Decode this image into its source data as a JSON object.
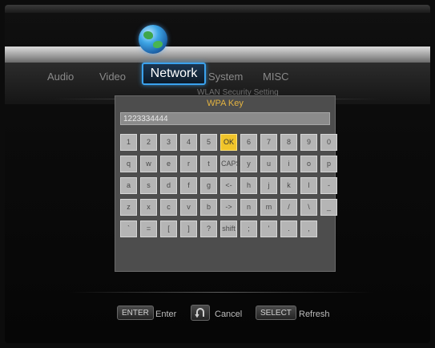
{
  "tabs": [
    {
      "label": "Audio"
    },
    {
      "label": "Video"
    },
    {
      "label": "Network"
    },
    {
      "label": "System"
    },
    {
      "label": "MISC"
    }
  ],
  "active_tab": "Network",
  "subtitle": "WLAN Security Setting",
  "dialog": {
    "title": "WPA Key",
    "value": "1223334444"
  },
  "keyboard": {
    "rows": [
      [
        "1",
        "2",
        "3",
        "4",
        "5",
        "OK",
        "6",
        "7",
        "8",
        "9",
        "0"
      ],
      [
        "q",
        "w",
        "e",
        "r",
        "t",
        "CAPS",
        "y",
        "u",
        "i",
        "o",
        "p"
      ],
      [
        "a",
        "s",
        "d",
        "f",
        "g",
        "<-",
        "h",
        "j",
        "k",
        "l",
        "-"
      ],
      [
        "z",
        "x",
        "c",
        "v",
        "b",
        "->",
        "n",
        "m",
        "/",
        "\\",
        "_"
      ],
      [
        "`",
        "=",
        "[",
        "]",
        "?",
        "shift",
        ";",
        "'",
        ".",
        ","
      ]
    ],
    "selected": "OK"
  },
  "footer": {
    "enter_key": "ENTER",
    "enter_label": "Enter",
    "cancel_label": "Cancel",
    "select_key": "SELECT",
    "select_label": "Refresh"
  },
  "colors": {
    "accent": "#3aa2ee",
    "highlight_key": "#f0c42a",
    "title": "#e3b341"
  }
}
